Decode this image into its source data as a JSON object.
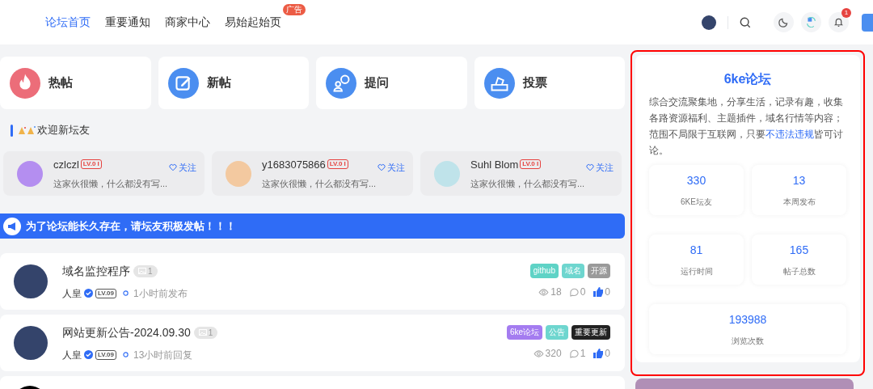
{
  "nav": {
    "items": [
      {
        "label": "论坛首页",
        "selected": true
      },
      {
        "label": "重要通知",
        "selected": false
      },
      {
        "label": "商家中心",
        "selected": false
      },
      {
        "label": "易始起始页",
        "selected": false,
        "badge": "广告"
      }
    ],
    "notification_count": "1"
  },
  "quick_links": [
    {
      "label": "热帖",
      "kind": "hot",
      "color": "#ec6d79"
    },
    {
      "label": "新帖",
      "kind": "new",
      "color": "#4b8ef0"
    },
    {
      "label": "提问",
      "kind": "ask",
      "color": "#4b8ef0"
    },
    {
      "label": "投票",
      "kind": "vote",
      "color": "#4b8ef0"
    }
  ],
  "welcome": {
    "title": "欢迎新坛友",
    "users": [
      {
        "name": "czlczl",
        "level": "LV.0 I",
        "bio": "这家伙很懒，什么都没有写...",
        "follow": "关注"
      },
      {
        "name": "y1683075866",
        "level": "LV.0 I",
        "bio": "这家伙很懒，什么都没有写...",
        "follow": "关注"
      },
      {
        "name": "Suhl Blom",
        "level": "LV.0 I",
        "bio": "这家伙很懒，什么都没有写...",
        "follow": "关注"
      }
    ]
  },
  "announcement": "为了论坛能长久存在，请坛友积极发帖！！！",
  "posts": [
    {
      "title": "域名监控程序",
      "images": "1",
      "author": "人皇",
      "level": "LV.09",
      "time": "1小时前发布",
      "tags": [
        {
          "label": "github",
          "color": "#5fd3c6"
        },
        {
          "label": "域名",
          "color": "#6ed6cf"
        },
        {
          "label": "开源",
          "color": "#9a9a9a"
        }
      ],
      "views": "18",
      "comments": "0",
      "likes": "0"
    },
    {
      "title": "网站更新公告-2024.09.30",
      "images": "1",
      "author": "人皇",
      "level": "LV.09",
      "time": "13小时前回复",
      "tags": [
        {
          "label": "6ke论坛",
          "color": "#a47cf0"
        },
        {
          "label": "公告",
          "color": "#6ed6cf"
        },
        {
          "label": "重要更新",
          "color": "#222222"
        }
      ],
      "views": "320",
      "comments": "1",
      "likes": "0"
    }
  ],
  "sidebar": {
    "title": "6ke论坛",
    "description": "综合交流聚集地，分享生活，记录有趣，收集各路资源福利、主题插件，域名行情等内容；范围不局限于互联网，只要",
    "link": "不违法违规",
    "description_end": "皆可讨论。",
    "stats": [
      {
        "value": "330",
        "label": "6KE坛友"
      },
      {
        "value": "13",
        "label": "本周发布"
      },
      {
        "value": "81",
        "label": "运行时间"
      },
      {
        "value": "165",
        "label": "帖子总数"
      },
      {
        "value": "193988",
        "label": "浏览次数"
      }
    ]
  }
}
